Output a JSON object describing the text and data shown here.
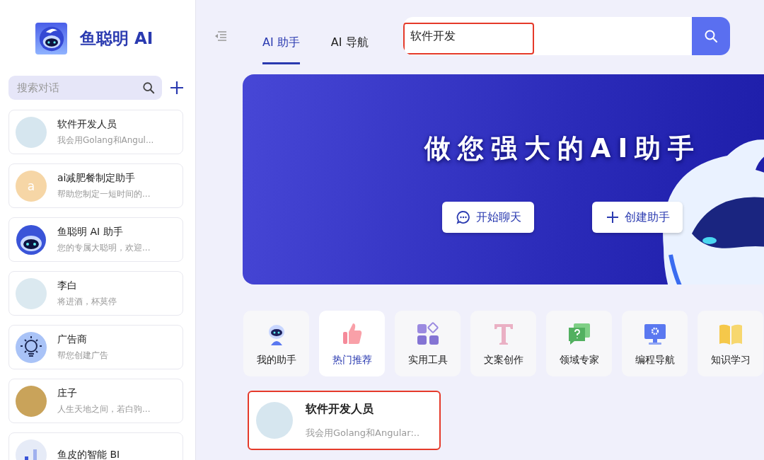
{
  "brand": {
    "name": "鱼聪明 AI"
  },
  "sidebar": {
    "search": {
      "placeholder": "搜索对话"
    },
    "items": [
      {
        "kind": "picture",
        "title": "软件开发人员",
        "subtitle": "我会用Golang和Angul...",
        "color": "#d6e6ef"
      },
      {
        "kind": "letter",
        "letter": "a",
        "title": "ai减肥餐制定助手",
        "subtitle": "帮助您制定一短时间的...",
        "color": "#f6d6a6"
      },
      {
        "kind": "logo",
        "title": "鱼聪明 AI 助手",
        "subtitle": "您的专属大聪明，欢迎...",
        "color": "#3a54d8"
      },
      {
        "kind": "picture",
        "title": "李白",
        "subtitle": "将进酒，杯莫停",
        "color": "#dbe9f0"
      },
      {
        "kind": "bulb",
        "title": "广告商",
        "subtitle": "帮您创建广告",
        "color": "#a9c3f7"
      },
      {
        "kind": "picture",
        "title": "庄子",
        "subtitle": "人生天地之间，若白驹...",
        "color": "#c9a35a"
      },
      {
        "kind": "chart",
        "title": "鱼皮的智能 BI",
        "color": "#e6ebf7"
      }
    ]
  },
  "tabs": [
    {
      "label": "AI 助手",
      "selected": true
    },
    {
      "label": "AI 导航",
      "selected": false
    }
  ],
  "search": {
    "value": "软件开发",
    "highlighted": true
  },
  "banner": {
    "title": "做您强大的AI助手",
    "buttons": [
      {
        "kind": "chat",
        "label": "开始聊天"
      },
      {
        "kind": "plus",
        "label": "创建助手"
      }
    ]
  },
  "categories": [
    {
      "kind": "robot",
      "label": "我的助手",
      "selected": false
    },
    {
      "kind": "thumb",
      "label": "热门推荐",
      "selected": true
    },
    {
      "kind": "grid",
      "label": "实用工具",
      "selected": false
    },
    {
      "kind": "letter",
      "label": "文案创作",
      "selected": false
    },
    {
      "kind": "question",
      "label": "领域专家",
      "selected": false
    },
    {
      "kind": "monitor",
      "label": "编程导航",
      "selected": false
    },
    {
      "kind": "book",
      "label": "知识学习",
      "selected": false
    }
  ],
  "results": [
    {
      "title": "软件开发人员",
      "subtitle": "我会用Golang和Angular:..",
      "color": "#d6e6ef",
      "highlighted": true
    }
  ]
}
